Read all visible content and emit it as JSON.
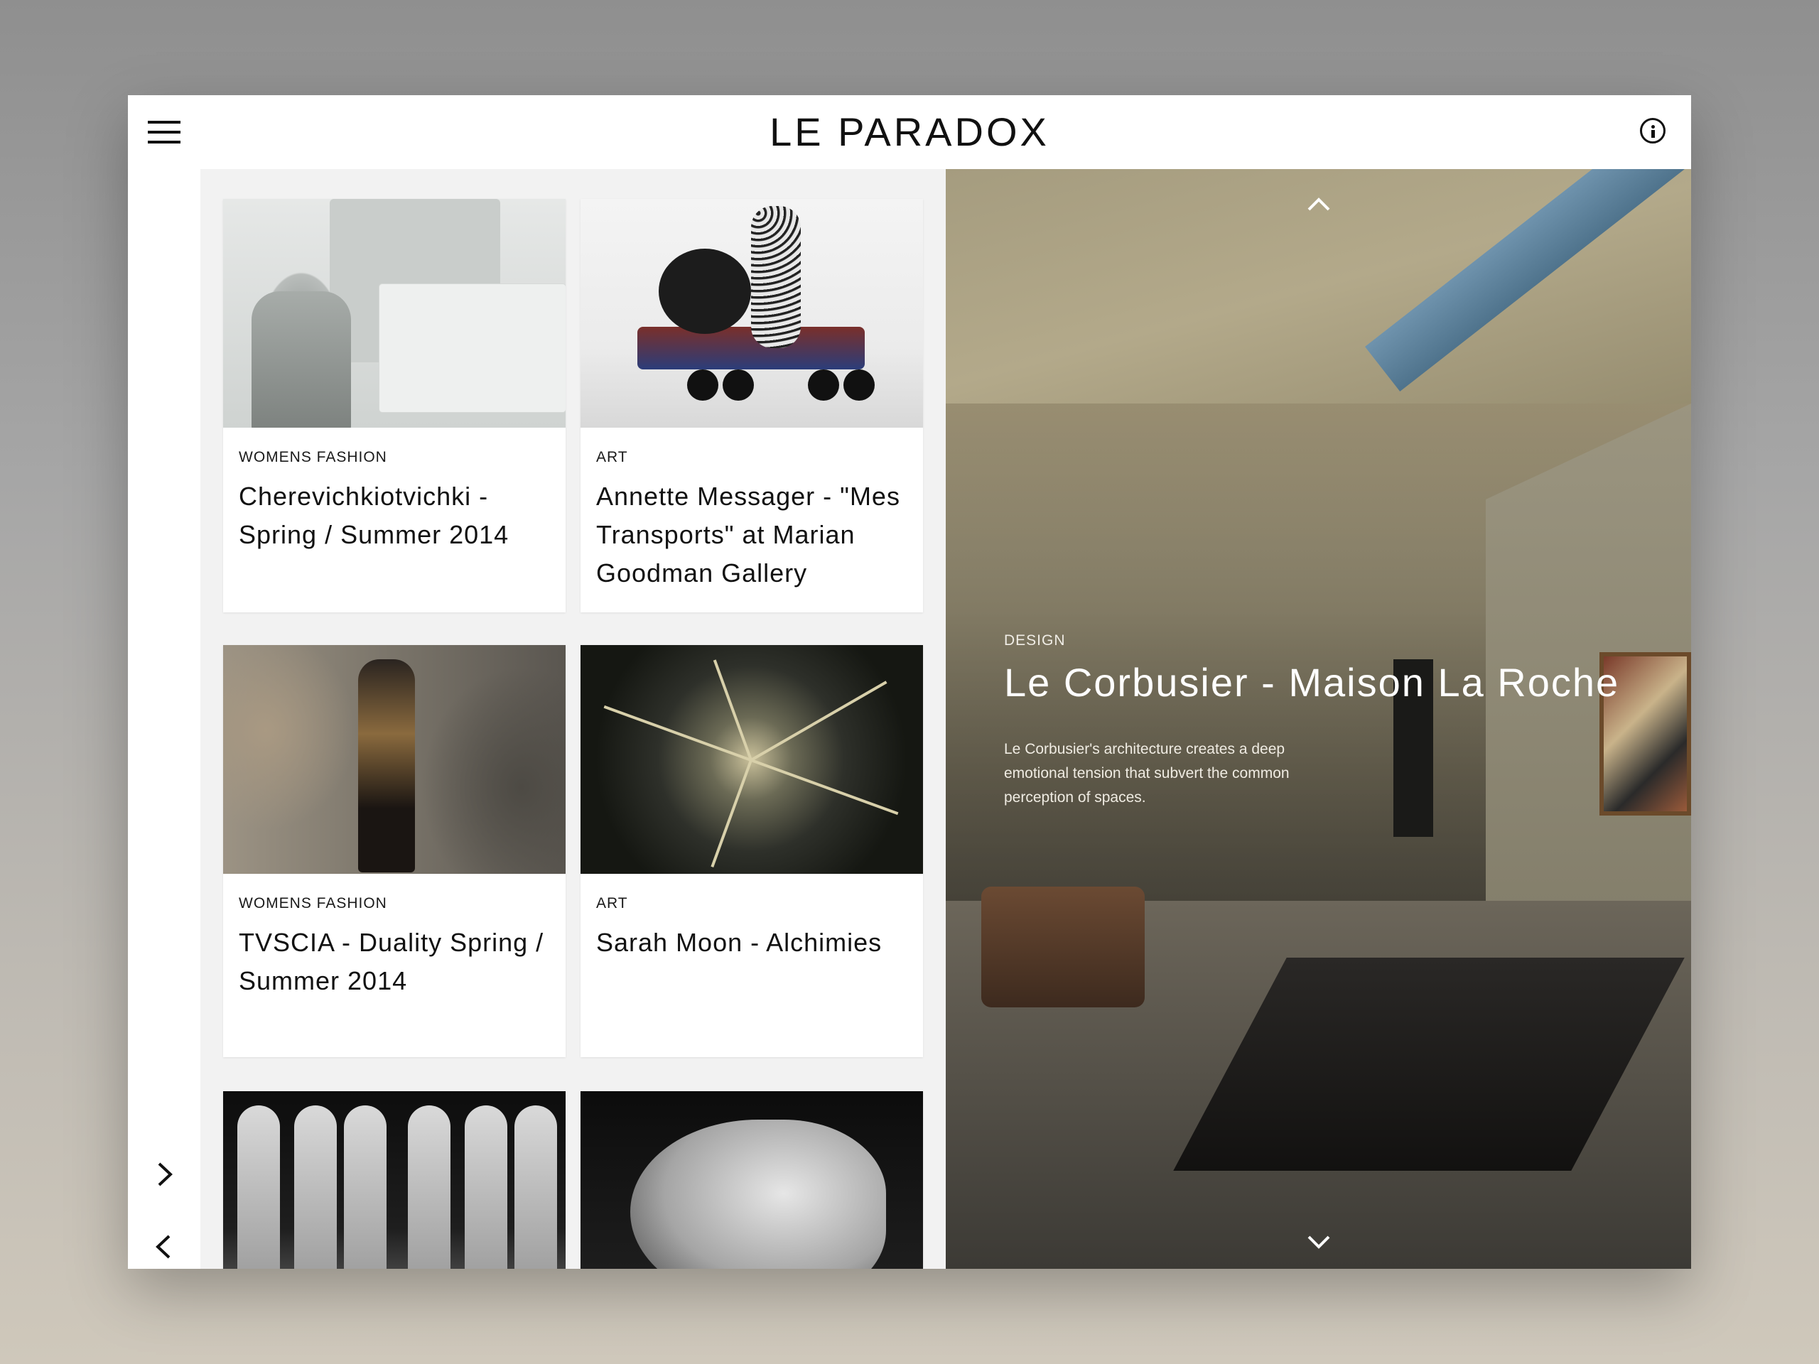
{
  "header": {
    "brand": "LE PARADOX",
    "menu_icon": "hamburger-menu-icon",
    "info_icon": "info-icon"
  },
  "rail": {
    "next_icon": "chevron-right-icon",
    "prev_icon": "chevron-left-icon",
    "repeat_icon": "repeat-icon"
  },
  "cards": [
    {
      "category": "WOMENS FASHION",
      "title": "Cherevichkiotvichki - Spring / Summer 2014"
    },
    {
      "category": "ART",
      "title": "Annette Messager - \"Mes Transports\" at Marian Goodman Gallery"
    },
    {
      "category": "WOMENS FASHION",
      "title": "TVSCIA - Duality Spring / Summer 2014"
    },
    {
      "category": "ART",
      "title": "Sarah Moon - Alchimies"
    }
  ],
  "feature": {
    "category": "DESIGN",
    "title": "Le Corbusier - Maison La Roche",
    "description": "Le Corbusier's architecture creates a deep emotional tension that subvert the common perception of spaces.",
    "up_icon": "chevron-up-icon",
    "down_icon": "chevron-down-icon"
  },
  "colors": {
    "background": "#ffffff",
    "grid_background": "#f2f2f2",
    "text": "#111111"
  }
}
